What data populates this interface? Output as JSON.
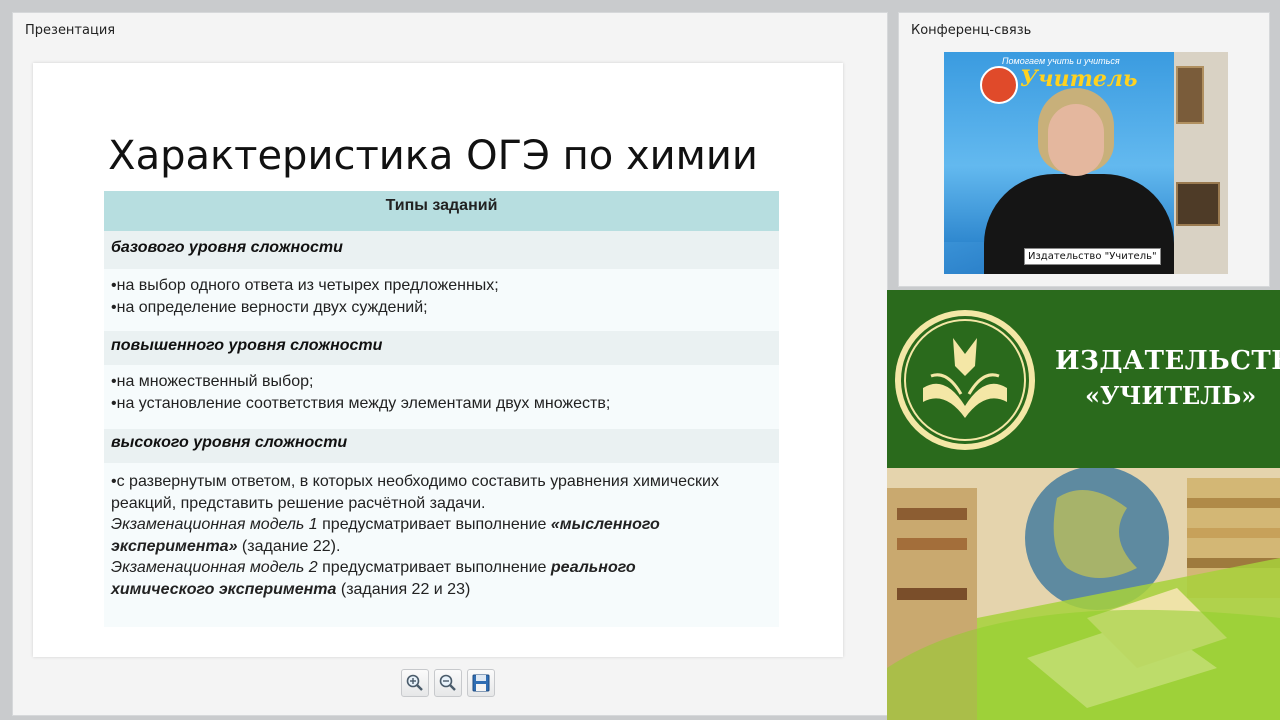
{
  "presentation_panel": {
    "title": "Презентация"
  },
  "conference_panel": {
    "title": "Конференц-связь"
  },
  "slide": {
    "title": "Характеристика ОГЭ по химии",
    "table_header": "Типы заданий",
    "sections": [
      {
        "level": "базового уровня сложности",
        "lines": [
          "•на выбор одного ответа из четырех предложенных;",
          "•на определение верности двух суждений;"
        ]
      },
      {
        "level": "повышенного уровня сложности",
        "lines": [
          "•на множественный выбор;",
          "•на установление соответствия между элементами двух множеств;"
        ]
      },
      {
        "level": "высокого уровня сложности",
        "lines": [
          "•с развернутым ответом, в которых необходимо составить уравнения химических",
          "реакций, представить решение расчётной задачи."
        ],
        "model1": {
          "lead": "Экзаменационная модель 1",
          "mid": " предусматривает выполнение ",
          "emph1": "«мысленного",
          "emph2": "эксперимента»",
          "tail": " (задание 22)."
        },
        "model2": {
          "lead": "Экзаменационная модель 2",
          "mid": " предусматривает выполнение ",
          "emph1": "реального",
          "emph2": "химического эксперимента",
          "tail": " (задания 22 и 23)"
        }
      }
    ]
  },
  "toolbar": {
    "buttons": [
      {
        "icon": "zoom-in-icon"
      },
      {
        "icon": "zoom-out-icon"
      },
      {
        "icon": "save-icon"
      }
    ]
  },
  "video": {
    "participant_label": "Издательство \"Учитель\"",
    "banner_small": "Помогаем учить и учиться",
    "banner_big": "Учитель"
  },
  "branding": {
    "line1": "ИЗДАТЕЛЬСТВО",
    "line2": "«УЧИТЕЛЬ»",
    "colors": {
      "green": "#2a6a1c",
      "gold": "#f4e7a6"
    }
  }
}
